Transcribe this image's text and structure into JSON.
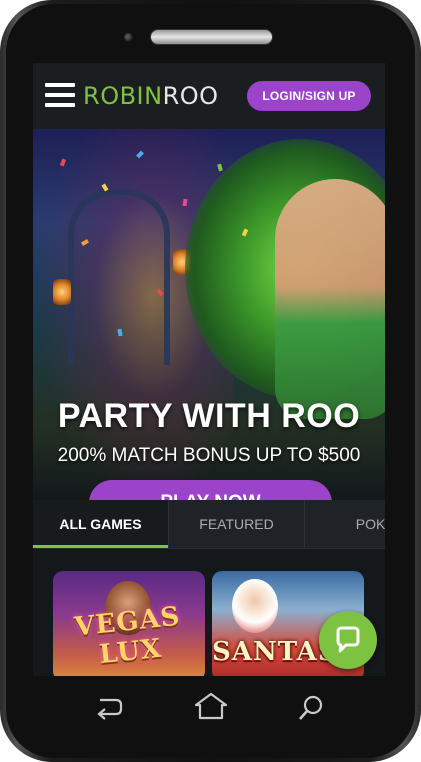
{
  "header": {
    "logo_part1": "R",
    "logo_o": "O",
    "logo_part2": "BIN",
    "logo_part3": "ROO",
    "login_label": "LOGIN/SIGN UP"
  },
  "hero": {
    "title": "PARTY WITH ROO",
    "subtitle": "200% MATCH BONUS UP TO $500",
    "cta_label": "PLAY NOW"
  },
  "tabs": [
    {
      "label": "ALL GAMES",
      "active": true
    },
    {
      "label": "FEATURED",
      "active": false
    },
    {
      "label": "POKI",
      "active": false
    }
  ],
  "games": [
    {
      "title": "VEGAS LUX"
    },
    {
      "title": "SANTASTIC"
    }
  ],
  "colors": {
    "accent_purple": "#9b43c9",
    "accent_green": "#7ec242",
    "header_bg": "#1b1e21"
  },
  "icons": {
    "menu": "hamburger-icon",
    "chat": "chat-bubble-icon",
    "back": "back-icon",
    "home": "home-icon",
    "search": "search-icon"
  }
}
